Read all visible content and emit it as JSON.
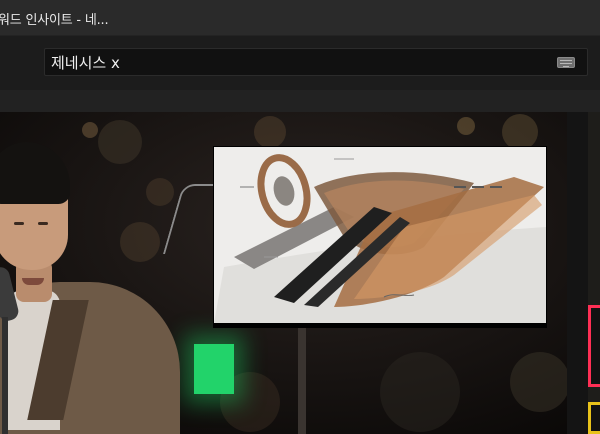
{
  "window": {
    "title": "워드 인사이트 - 네..."
  },
  "search": {
    "value": "제네시스 x",
    "keyboard_icon": "keyboard-icon"
  },
  "colors": {
    "accent_pink": "#ff2f55",
    "accent_yellow": "#e8c21a",
    "green_light": "#22d36a"
  }
}
